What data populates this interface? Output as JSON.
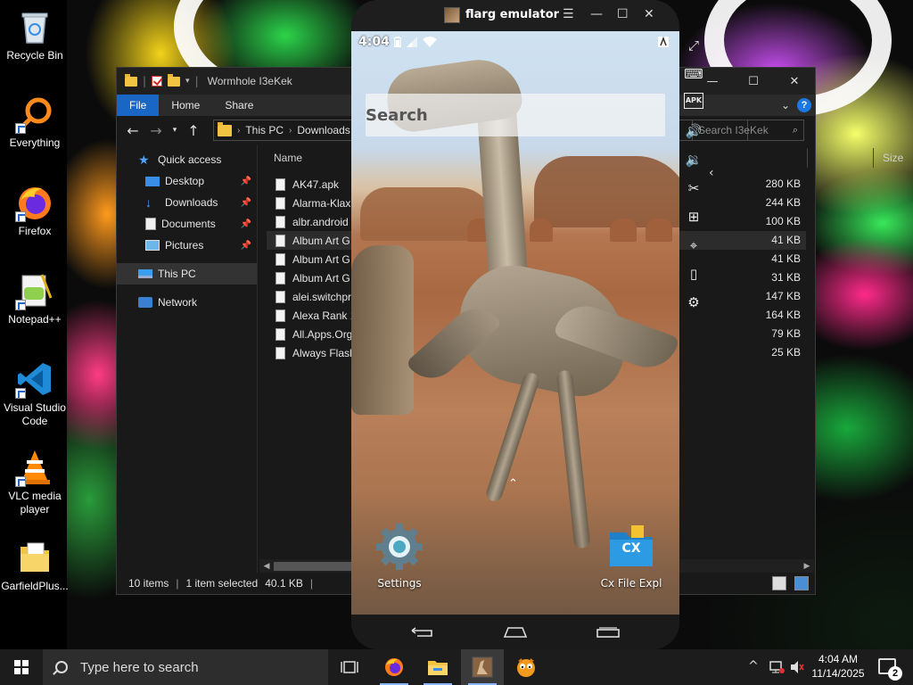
{
  "desktop": {
    "icons": [
      {
        "label": "Recycle Bin",
        "icon": "recycle-bin-icon"
      },
      {
        "label": "Everything",
        "icon": "everything-search-icon"
      },
      {
        "label": "Firefox",
        "icon": "firefox-icon"
      },
      {
        "label": "Notepad++",
        "icon": "notepadpp-icon"
      },
      {
        "label": "Visual Studio Code",
        "icon": "vscode-icon"
      },
      {
        "label": "VLC media player",
        "icon": "vlc-icon"
      },
      {
        "label": "GarfieldPlus...",
        "icon": "folder-icon"
      }
    ]
  },
  "explorer": {
    "title": "Wormhole I3eKek",
    "window_controls": {
      "minimize": "—",
      "maximize": "☐",
      "close": "✕"
    },
    "ribbon_tabs": [
      "File",
      "Home",
      "Share"
    ],
    "address": {
      "root": "This PC",
      "current": "Downloads"
    },
    "search_placeholder": "Search I3eKek",
    "sidebar": [
      {
        "label": "Quick access",
        "icon": "star-icon",
        "pinned": false
      },
      {
        "label": "Desktop",
        "icon": "desktop-folder-icon",
        "pinned": true
      },
      {
        "label": "Downloads",
        "icon": "downloads-icon",
        "pinned": true
      },
      {
        "label": "Documents",
        "icon": "documents-icon",
        "pinned": true
      },
      {
        "label": "Pictures",
        "icon": "pictures-icon",
        "pinned": true
      },
      {
        "label": "This PC",
        "icon": "computer-icon",
        "pinned": false,
        "selected": true
      },
      {
        "label": "Network",
        "icon": "network-icon",
        "pinned": false
      }
    ],
    "columns": {
      "name": "Name",
      "size": "Size"
    },
    "files": [
      {
        "name": "AK47.apk",
        "size": "280 KB"
      },
      {
        "name": "Alarma-Klax",
        "size": "244 KB"
      },
      {
        "name": "albr.android",
        "size": "100 KB"
      },
      {
        "name": "Album Art G",
        "size": "41 KB",
        "selected": true
      },
      {
        "name": "Album Art G",
        "size": "41 KB"
      },
      {
        "name": "Album Art G",
        "size": "31 KB"
      },
      {
        "name": "alei.switchpr",
        "size": "147 KB"
      },
      {
        "name": "Alexa Rank 1",
        "size": "164 KB"
      },
      {
        "name": "All.Apps.Org",
        "size": "79 KB"
      },
      {
        "name": "Always Flash",
        "size": "25 KB"
      }
    ],
    "status": {
      "items": "10 items",
      "selected": "1 item selected",
      "selected_size": "40.1 KB"
    }
  },
  "emulator": {
    "title": "flarg emulator",
    "window_controls": {
      "menu": "☰",
      "minimize": "—",
      "maximize": "☐",
      "close": "✕"
    },
    "status_time": "4:04",
    "search_label": "Search",
    "apps": [
      {
        "name": "Settings",
        "icon": "settings-gear-icon"
      },
      {
        "name": "Cx File Expl",
        "icon": "cx-file-explorer-icon",
        "badge": "CX"
      }
    ],
    "side_tools": [
      "fullscreen-icon",
      "keyboard-icon",
      "apk-install-icon",
      "volume-up-icon",
      "volume-down-icon",
      "scissors-icon",
      "add-window-icon",
      "location-icon",
      "shake-icon",
      "settings-icon"
    ],
    "apk_label": "APK"
  },
  "taskbar": {
    "search_placeholder": "Type here to search",
    "time": "4:04 AM",
    "date": "11/14/2025",
    "notification_count": "2",
    "pinned_apps": [
      "task-view-icon",
      "firefox-icon",
      "file-explorer-icon",
      "flarg-emulator-icon",
      "garfield-icon"
    ]
  }
}
